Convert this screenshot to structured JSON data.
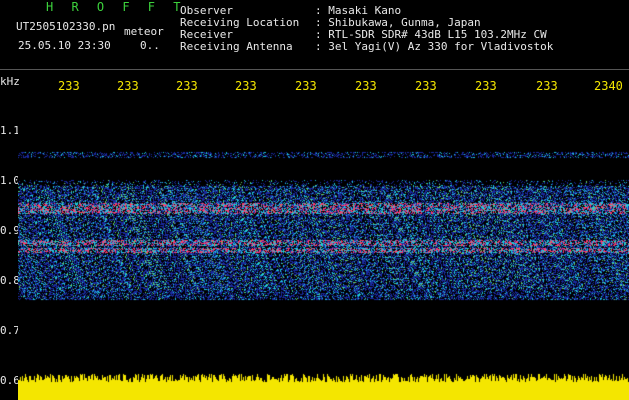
{
  "header": {
    "title": "H R O F F T",
    "filename": "UT2505102330.pn",
    "meteor_label": "meteor",
    "date": "25.05.10",
    "time": "23:30",
    "count": "0.."
  },
  "info": [
    {
      "key": "Observer",
      "value": ": Masaki Kano"
    },
    {
      "key": "Receiving Location",
      "value": ": Shibukawa, Gunma, Japan"
    },
    {
      "key": "Receiver",
      "value": ": RTL-SDR SDR# 43dB L15 103.2MHz CW"
    },
    {
      "key": "Receiving Antenna",
      "value": ": 3el Yagi(V) Az 330 for Vladivostok"
    }
  ],
  "axis": {
    "y_unit": "kHz",
    "y_ticks": [
      "1.1",
      "1.0",
      "0.9",
      "0.8",
      "0.7",
      "0.6"
    ],
    "x_ticks": [
      "233",
      "233",
      "233",
      "233",
      "233",
      "233",
      "233",
      "233",
      "233",
      "2340"
    ]
  },
  "colors": {
    "background": "#000000",
    "title": "#3cd23c",
    "x_labels": "#f4e600",
    "noise_floor": "#f4e600",
    "signal_low": "#1a2aa0",
    "signal_mid": "#1ec8e0",
    "signal_high": "#ff3c6e"
  }
}
